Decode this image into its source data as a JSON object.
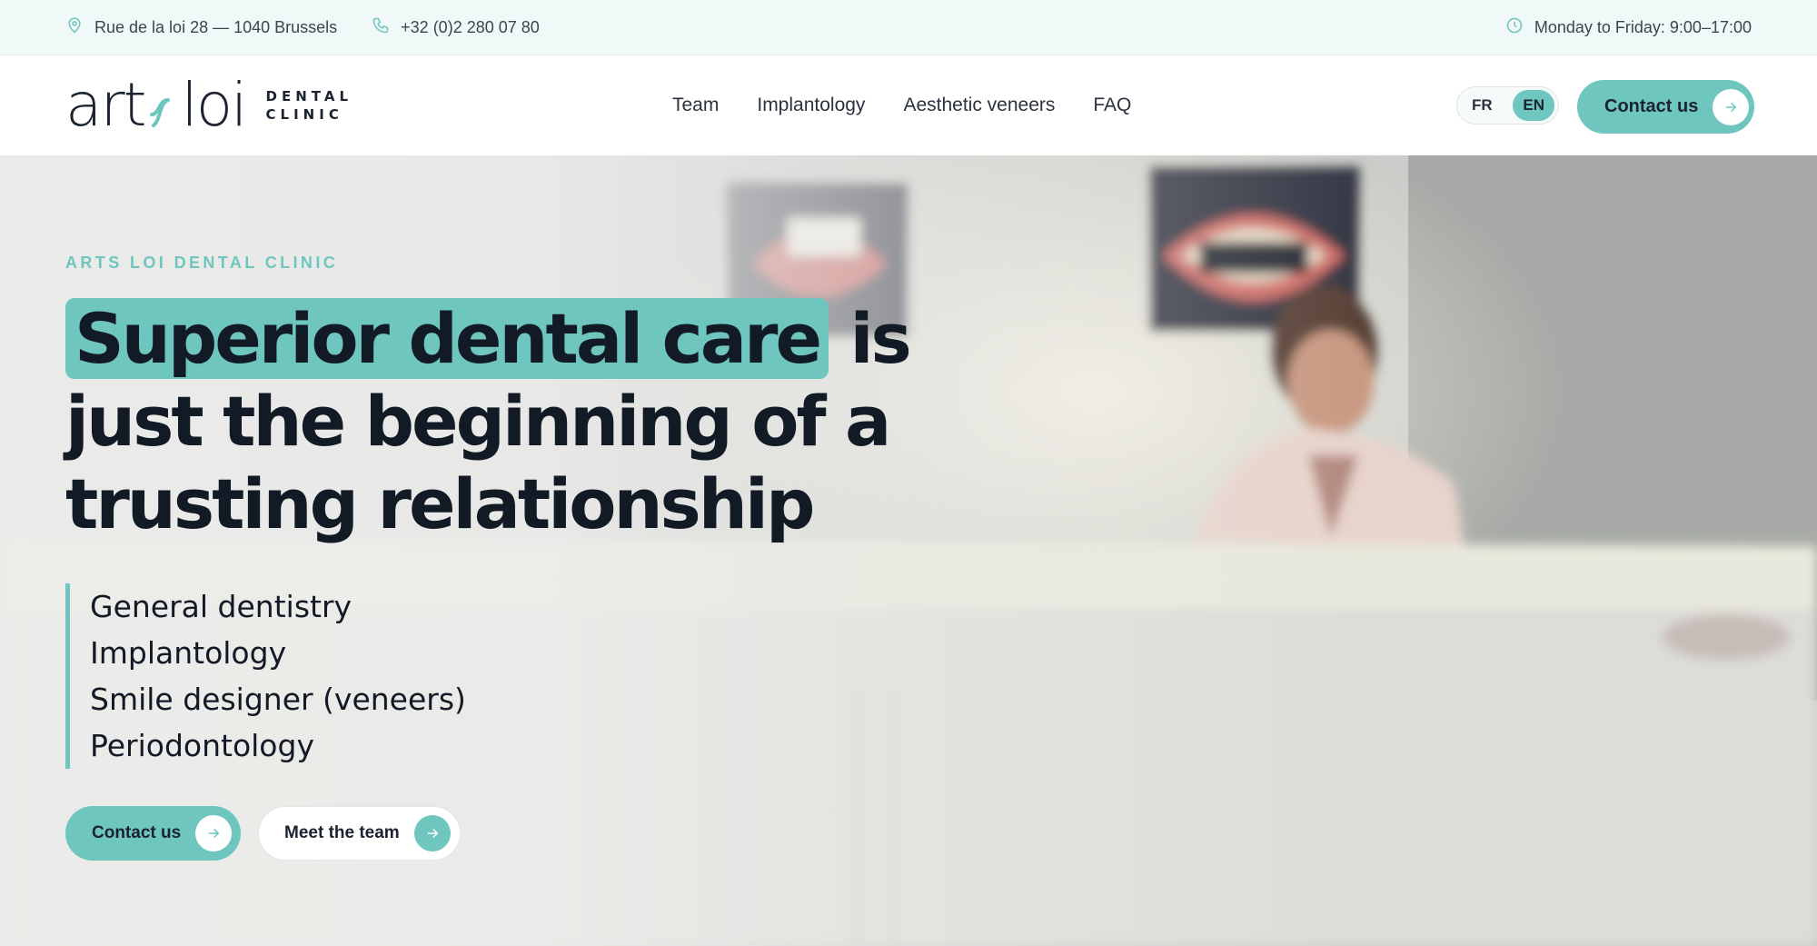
{
  "topbar": {
    "address": "Rue de la loi 28 — 1040 Brussels",
    "phone": "+32 (0)2 280 07 80",
    "hours": "Monday to Friday: 9:00–17:00"
  },
  "header": {
    "logo": {
      "word_left": "art",
      "word_right": "loi",
      "sub_line1": "DENTAL",
      "sub_line2": "CLINIC"
    },
    "nav": [
      "Team",
      "Implantology",
      "Aesthetic veneers",
      "FAQ"
    ],
    "languages": [
      "FR",
      "EN"
    ],
    "active_language": "EN",
    "contact_label": "Contact us"
  },
  "hero": {
    "eyebrow": "ARTS LOI DENTAL CLINIC",
    "headline_highlight": "Superior dental care",
    "headline_rest": "is just the beginning of a trusting relationship",
    "services": [
      "General dentistry",
      "Implantology",
      "Smile designer (veneers)",
      "Periodontology"
    ],
    "primary_cta": "Contact us",
    "secondary_cta": "Meet the team"
  },
  "icons": {
    "address": "map-pin-icon",
    "phone": "phone-icon",
    "hours": "clock-icon",
    "cta": "arrow-right-icon"
  },
  "colors": {
    "accent": "#6ec6bf",
    "text_dark": "#121a26",
    "topbar_bg": "#f1f8f8"
  }
}
